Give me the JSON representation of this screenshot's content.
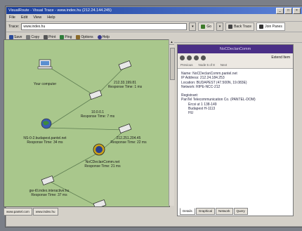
{
  "window": {
    "title": "VisualRoute - Visual Trace - www.index.hu (212.24.144.245)",
    "buttons": [
      "_",
      "□",
      "×"
    ]
  },
  "menu": [
    "File",
    "Edit",
    "View",
    "Help"
  ],
  "address": {
    "label": "Trace:",
    "value": "www.index.hu",
    "go_label": "Go",
    "back_trace_label": "Back Trace",
    "join_panes_label": "Join Panes"
  },
  "toolbar": [
    "Save",
    "Copy",
    "Print",
    "Ping",
    "Options",
    "Help"
  ],
  "map": {
    "background": "#a9c78c",
    "nodes": [
      {
        "id": "you",
        "label": "Your computer",
        "sub": "",
        "icon": "laptop-icon"
      },
      {
        "id": "n1",
        "label": "212.33.199.81",
        "sub": "Response Time: 1 ms",
        "icon": "router-icon"
      },
      {
        "id": "n2",
        "label": "10.0.0.1",
        "sub": "Response Time: 7 ms",
        "icon": "router-icon"
      },
      {
        "id": "n3",
        "label": "NS-0-2.budapest.pantel.net",
        "sub": "Response Time: 34 ms",
        "icon": "globe-icon"
      },
      {
        "id": "n4",
        "label": "212.251.204.45",
        "sub": "Response Time: 22 ms",
        "icon": "router-icon"
      },
      {
        "id": "n5",
        "label": "NoCDeclanComm.net",
        "sub": "Response Time: 21 ms",
        "icon": "globe-icon"
      },
      {
        "id": "n6",
        "label": "gw-t0.index.interactive.hu",
        "sub": "Response Time: 37 ms",
        "icon": "router-icon"
      },
      {
        "id": "n7",
        "label": "",
        "sub": "",
        "icon": "router-icon"
      }
    ]
  },
  "bottom_tabs": [
    "www.pantel.com",
    "www.index.hu"
  ],
  "panel": {
    "header": "NoCDeclanComm",
    "tools_label": "Extend Item",
    "nav": [
      "Previous",
      "Node 5 of 8",
      "Next"
    ],
    "details": [
      "Name: NoCDeclanComm.pantel.net",
      "IP Address: 212.24.184.253",
      "Location: BUDAPEST (47.500N, 19.083E)",
      "Network: RIPE-NCC-212"
    ],
    "registrant_title": "Registrant:",
    "registrant_lines": [
      "PanTel Telecommunication Co. (PANTEL-DOM)",
      "Ercsi ut 1 138-149",
      "Budapest H-1113",
      "HU"
    ],
    "tabs": [
      "Details",
      "Graphical",
      "Network",
      "Query"
    ]
  }
}
